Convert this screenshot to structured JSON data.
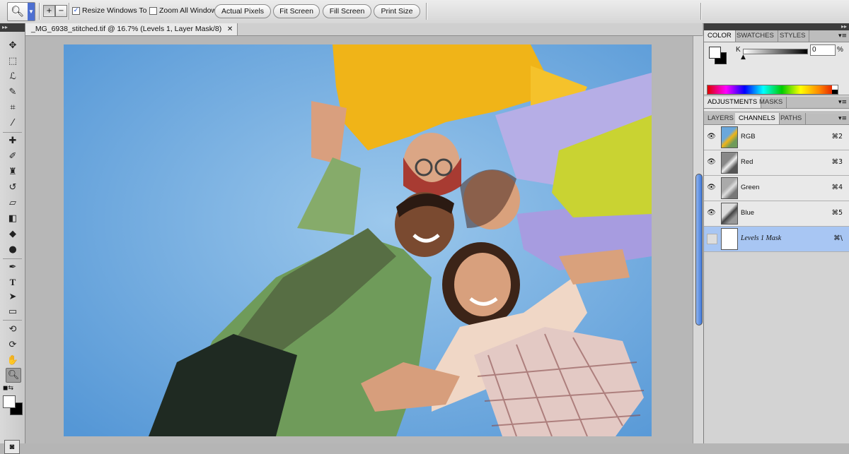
{
  "options_bar": {
    "tool_preset_icon": "magnifier-icon",
    "zoom_in_icon": "zoom-in-icon",
    "zoom_out_icon": "zoom-out-icon",
    "resize_windows_label": "Resize Windows To Fit",
    "resize_windows_checked": true,
    "zoom_all_label": "Zoom All Windows",
    "zoom_all_checked": false,
    "actual_pixels_label": "Actual Pixels",
    "fit_screen_label": "Fit Screen",
    "fill_screen_label": "Fill Screen",
    "print_size_label": "Print Size"
  },
  "document": {
    "tab_title": "_MG_6938_stitched.tif @ 16.7% (Levels 1, Layer Mask/8)",
    "close_glyph": "✕"
  },
  "toolbox": {
    "tools": [
      "move",
      "marquee",
      "lasso",
      "quick-selection",
      "crop",
      "eyedropper",
      "spot-healing",
      "brush",
      "clone-stamp",
      "history-brush",
      "eraser",
      "gradient",
      "blur",
      "dodge",
      "pen",
      "type",
      "path-selection",
      "rectangle",
      "3d-rotate",
      "3d-orbit",
      "hand",
      "zoom"
    ],
    "active_tool": "zoom"
  },
  "color_panel": {
    "tabs": [
      "COLOR",
      "SWATCHES",
      "STYLES"
    ],
    "active_tab": "COLOR",
    "slider_label": "K",
    "slider_value": "0",
    "unit": "%"
  },
  "adjustments_panel": {
    "tabs": [
      "ADJUSTMENTS",
      "MASKS"
    ],
    "active_tab": "ADJUSTMENTS"
  },
  "layers_panel": {
    "tabs": [
      "LAYERS",
      "CHANNELS",
      "PATHS"
    ],
    "active_tab": "CHANNELS",
    "channels": [
      {
        "name": "RGB",
        "shortcut": "⌘2",
        "visible": true
      },
      {
        "name": "Red",
        "shortcut": "⌘3",
        "visible": true
      },
      {
        "name": "Green",
        "shortcut": "⌘4",
        "visible": true
      },
      {
        "name": "Blue",
        "shortcut": "⌘5",
        "visible": true
      },
      {
        "name": "Levels 1 Mask",
        "shortcut": "⌘\\",
        "visible": false,
        "selected": true
      }
    ]
  },
  "colors": {
    "selection": "#a8c6f3",
    "scroll_thumb": "#3f78d9"
  }
}
